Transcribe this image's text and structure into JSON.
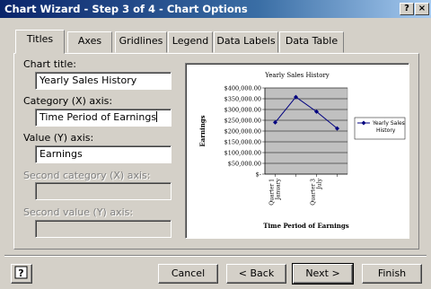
{
  "window": {
    "title": "Chart Wizard - Step 3 of 4 - Chart Options",
    "help_glyph": "?",
    "close_glyph": "×"
  },
  "tabs": [
    {
      "label": "Titles",
      "active": true
    },
    {
      "label": "Axes",
      "active": false
    },
    {
      "label": "Gridlines",
      "active": false
    },
    {
      "label": "Legend",
      "active": false
    },
    {
      "label": "Data Labels",
      "active": false
    },
    {
      "label": "Data Table",
      "active": false
    }
  ],
  "fields": {
    "chart_title": {
      "label": "Chart title:",
      "value": "Yearly Sales History"
    },
    "category_x": {
      "label": "Category (X) axis:",
      "value": "Time Period of Earnings"
    },
    "value_y": {
      "label": "Value (Y) axis:",
      "value": "Earnings"
    },
    "second_category_x": {
      "label": "Second category (X) axis:",
      "value": "",
      "enabled": false
    },
    "second_value_y": {
      "label": "Second value (Y) axis:",
      "value": "",
      "enabled": false
    }
  },
  "buttons": {
    "help_icon": "help-icon",
    "cancel": "Cancel",
    "back": "< Back",
    "next": "Next >",
    "finish": "Finish"
  },
  "chart_data": {
    "type": "line",
    "title": "Yearly Sales History",
    "xlabel": "Time Period of Earnings",
    "ylabel": "Earnings",
    "categories": [
      "Quarter 1 January",
      "",
      "Quarter 3 July",
      ""
    ],
    "series": [
      {
        "name": "Yearly Sales History",
        "values": [
          240000,
          358000,
          290000,
          212000
        ]
      }
    ],
    "ylim": [
      0,
      400000
    ],
    "yticks": [
      0,
      50000,
      100000,
      150000,
      200000,
      250000,
      300000,
      350000,
      400000
    ],
    "ytick_labels": [
      "$-",
      "$50,000.00",
      "$100,000.00",
      "$150,000.00",
      "$200,000.00",
      "$250,000.00",
      "$300,000.00",
      "$350,000.00",
      "$400,000.00"
    ],
    "plot_background": "#c0c0c0",
    "line_color": "#000080",
    "grid": true,
    "legend": "right"
  }
}
